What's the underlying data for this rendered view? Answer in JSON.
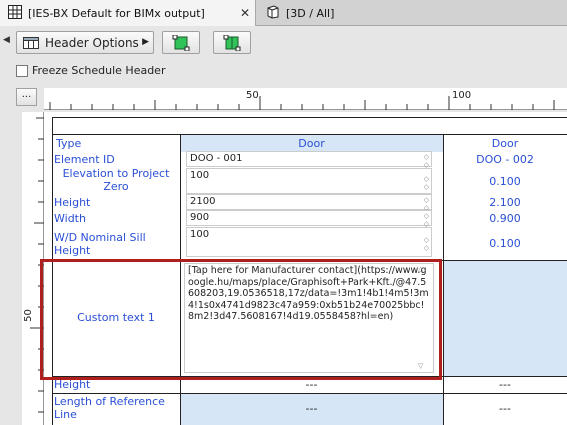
{
  "tabs": {
    "active_label": "[IES-BX Default for BIMx output]",
    "close_glyph": "✕",
    "inactive_label": "[3D / All]"
  },
  "toolbar": {
    "header_options_label": "Header Options",
    "freeze_label": "Freeze Schedule Header",
    "dots_label": "..."
  },
  "ruler": {
    "h_label_50": "50",
    "h_label_100": "100",
    "v_label_50": "50"
  },
  "schedule": {
    "row_labels": {
      "type": "Type",
      "element_id": "Element ID",
      "elevation": "Elevation to Project Zero",
      "height": "Height",
      "width": "Width",
      "wd_sill": "W/D Nominal Sill Height",
      "custom_text": "Custom text 1",
      "height2": "Height",
      "length_ref": "Length of Reference Line"
    },
    "col1": {
      "header": "Door",
      "element_id": "DOO - 001",
      "elevation": "100",
      "height": "2100",
      "width": "900",
      "wd_sill": "100",
      "custom_text": "[Tap here for Manufacturer contact](https://www.google.hu/maps/place/Graphisoft+Park+Kft./@47.5608203,19.0536518,17z/data=!3m1!4b1!4m5!3m4!1s0x4741d9823c47a959:0xb51b24e70025bbc!8m2!3d47.5608167!4d19.0558458?hl=en)",
      "height2": "---",
      "length_ref": "---"
    },
    "col2": {
      "header": "Door",
      "element_id": "DOO - 002",
      "elevation": "0.100",
      "height": "2.100",
      "width": "0.900",
      "wd_sill": "0.100",
      "height2": "---",
      "length_ref": "---"
    }
  },
  "colors": {
    "accent_blue": "#2a4fd6",
    "selected_column": "#d6e6f7",
    "highlight_red": "#b01e1e"
  }
}
